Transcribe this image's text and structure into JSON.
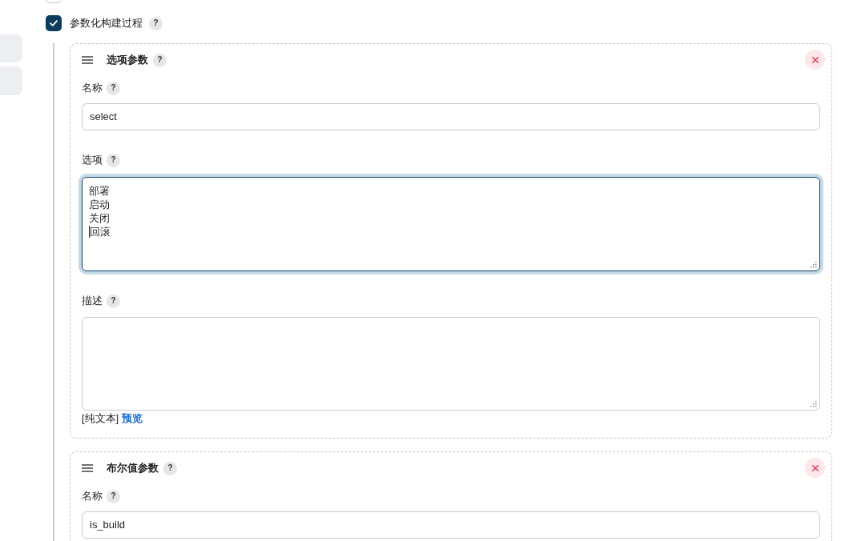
{
  "options": [
    {
      "checked": false
    },
    {
      "label": "参数化构建过程",
      "help": "?",
      "checked": true
    }
  ],
  "parameters": [
    {
      "title": "选项参数",
      "help": "?",
      "fields": [
        {
          "kind": "input",
          "label": "名称",
          "help": "?",
          "value": "select",
          "focused": false
        },
        {
          "kind": "textarea",
          "label": "选项",
          "help": "?",
          "focused": true,
          "lines": [
            {
              "text": "部署",
              "caret": false
            },
            {
              "text": "启动",
              "caret": false
            },
            {
              "text": "关闭",
              "caret": false
            },
            {
              "text": "回滚",
              "caret": true
            }
          ]
        },
        {
          "kind": "textarea",
          "label": "描述",
          "help": "?",
          "focused": false,
          "format_note": "[纯文本]",
          "preview_link": "预览"
        }
      ]
    },
    {
      "title": "布尔值参数",
      "help": "?",
      "fields": [
        {
          "kind": "input",
          "label": "名称",
          "help": "?",
          "value": "is_build",
          "focused": false
        }
      ]
    }
  ]
}
